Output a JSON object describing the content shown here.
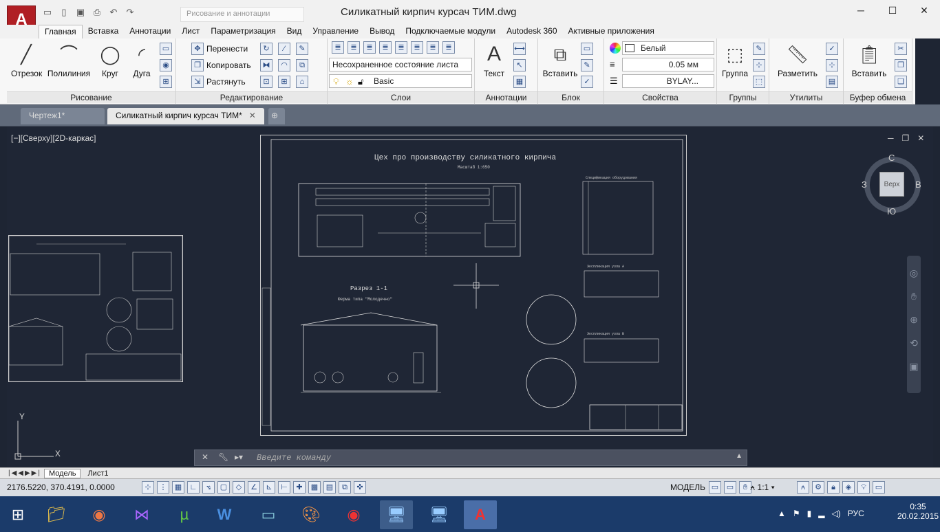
{
  "window": {
    "title": "Силикатный кирпич курсач ТИМ.dwg",
    "workspace_placeholder": "Рисование и аннотации",
    "app_icon": "autocad-logo"
  },
  "ribbon_tabs": [
    "Главная",
    "Вставка",
    "Аннотации",
    "Лист",
    "Параметризация",
    "Вид",
    "Управление",
    "Вывод",
    "Подключаемые модули",
    "Autodesk 360",
    "Активные приложения"
  ],
  "panels": {
    "draw": {
      "label": "Рисование",
      "tools": [
        "Отрезок",
        "Полилиния",
        "Круг",
        "Дуга"
      ]
    },
    "modify": {
      "label": "Редактирование",
      "tools": [
        "Перенести",
        "Копировать",
        "Растянуть"
      ]
    },
    "layers": {
      "label": "Слои",
      "state": "Несохраненное состояние листа",
      "current": "Basic"
    },
    "annotation": {
      "label": "Аннотации",
      "tool": "Текст"
    },
    "block": {
      "label": "Блок",
      "tool": "Вставить"
    },
    "properties": {
      "label": "Свойства",
      "color": "Белый",
      "lineweight": "0.05 мм",
      "linetype": "BYLAY..."
    },
    "groups": {
      "label": "Группы",
      "tool": "Группа"
    },
    "utilities": {
      "label": "Утилиты",
      "tool": "Разметить"
    },
    "clipboard": {
      "label": "Буфер обмена",
      "tool": "Вставить"
    }
  },
  "doc_tabs": [
    "Чертеж1*",
    "Силикатный кирпич курсач ТИМ*"
  ],
  "viewport": {
    "label": "[−][Сверху][2D-каркас]",
    "navcube": {
      "top": "Верх",
      "n": "С",
      "s": "Ю",
      "w": "З",
      "e": "В"
    }
  },
  "drawing": {
    "title": "Цех про производству силикатного кирпича",
    "scale": "Масштаб 1:650",
    "section": "Разрез 1-1",
    "truss": "Ферма типа \"Молодечно\"",
    "spec_title": "Спецификация оборудования",
    "node_a": "Экспликация узла А",
    "node_b": "Экспликация узла В"
  },
  "command": {
    "placeholder": "Введите команду"
  },
  "layout_tabs": [
    "Модель",
    "Лист1"
  ],
  "status": {
    "coords": "2176.5220, 370.4191, 0.0000",
    "mode": "МОДЕЛЬ",
    "scale": "1:1"
  },
  "taskbar": {
    "lang": "РУС",
    "time": "0:35",
    "date": "20.02.2015"
  }
}
